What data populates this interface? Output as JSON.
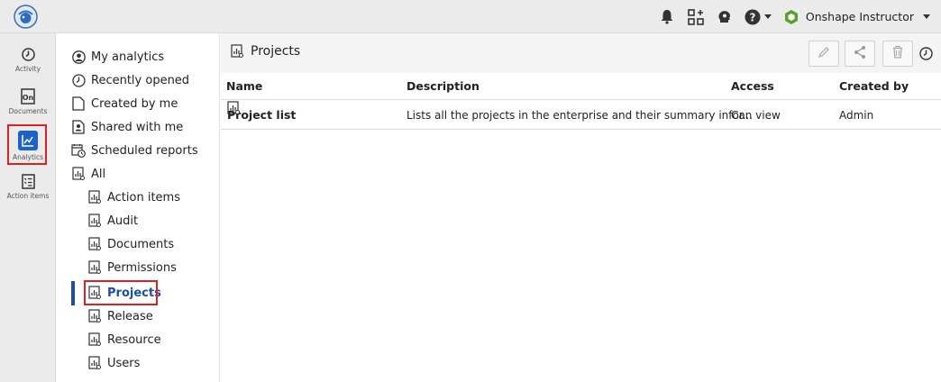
{
  "topbar": {
    "user_name": "Onshape Instructor"
  },
  "rail": {
    "items": [
      {
        "label": "Activity",
        "icon": "clock-icon"
      },
      {
        "label": "Documents",
        "icon": "documents-icon"
      },
      {
        "label": "Analytics",
        "icon": "analytics-icon"
      },
      {
        "label": "Action items",
        "icon": "checklist-icon"
      }
    ]
  },
  "nav": {
    "items": [
      {
        "label": "My analytics",
        "icon": "user-circle-icon"
      },
      {
        "label": "Recently opened",
        "icon": "clock-icon"
      },
      {
        "label": "Created by me",
        "icon": "page-icon"
      },
      {
        "label": "Shared with me",
        "icon": "shared-user-icon"
      },
      {
        "label": "Scheduled reports",
        "icon": "calendar-clock-icon"
      },
      {
        "label": "All",
        "icon": "report-icon"
      },
      {
        "label": "Action items",
        "icon": "report-icon"
      },
      {
        "label": "Audit",
        "icon": "report-icon"
      },
      {
        "label": "Documents",
        "icon": "report-icon"
      },
      {
        "label": "Permissions",
        "icon": "report-icon"
      },
      {
        "label": "Projects",
        "icon": "report-icon"
      },
      {
        "label": "Release",
        "icon": "report-icon"
      },
      {
        "label": "Resource",
        "icon": "report-icon"
      },
      {
        "label": "Users",
        "icon": "report-icon"
      }
    ],
    "active": "Projects"
  },
  "main": {
    "title": "Projects",
    "columns": {
      "name": "Name",
      "description": "Description",
      "access": "Access",
      "created_by": "Created by"
    },
    "rows": [
      {
        "name": "Project list",
        "description": "Lists all the projects in the enterprise and their summary infor...",
        "access": "Can view",
        "created_by": "Admin"
      }
    ]
  },
  "colors": {
    "accent": "#1b4ea8",
    "highlight_box": "#e02020",
    "brand_green": "#5aa02c"
  }
}
